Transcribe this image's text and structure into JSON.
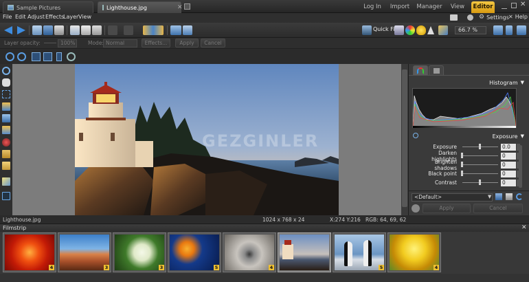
{
  "tabs": {
    "docs": [
      {
        "label": "Sample Pictures",
        "active": false
      },
      {
        "label": "Lighthouse.jpg",
        "active": true
      }
    ],
    "modes": [
      {
        "label": "Log In",
        "active": false
      },
      {
        "label": "Import",
        "active": false
      },
      {
        "label": "Manager",
        "active": false
      },
      {
        "label": "View",
        "active": false
      },
      {
        "label": "Editor",
        "active": true
      }
    ]
  },
  "menu": {
    "items": [
      "File",
      "Edit",
      "Adjust",
      "Effects",
      "Layer",
      "View"
    ],
    "settings": "Settings",
    "help": "Help"
  },
  "toolbar": {
    "quick_fix": "Quick Fix",
    "zoom_level": "66.7 %"
  },
  "options": {
    "layer_opacity_label": "Layer opacity:",
    "layer_opacity_value": "100%",
    "mode_label": "Mode:",
    "mode_value": "Normal",
    "effects_button": "Effects...",
    "apply_button": "Apply",
    "cancel_button": "Cancel"
  },
  "panel": {
    "histogram_title": "Histogram",
    "exposure_title": "Exposure",
    "adjustments": [
      {
        "label": "Exposure",
        "value": "0.0",
        "knob": 0.5
      },
      {
        "label": "Darken highlights",
        "value": "0",
        "knob": 0.0
      },
      {
        "label": "Brighten shadows",
        "value": "0",
        "knob": 0.0
      },
      {
        "label": "Black point",
        "value": "0",
        "knob": 0.0
      },
      {
        "label": "Contrast",
        "value": "0",
        "knob": 0.5
      }
    ],
    "preset": "<Default>",
    "apply_button": "Apply",
    "cancel_button": "Cancel"
  },
  "canvas": {
    "watermark": "GEZGINLER"
  },
  "status": {
    "filename": "Lighthouse.jpg",
    "dimensions": "1024 x 768 x 24",
    "coords": "X:274 Y:216",
    "rgb": "RGB: 64, 69, 62"
  },
  "filmstrip": {
    "title": "Filmstrip",
    "thumbs": [
      {
        "name": "Chrysanthemum",
        "badge": "4",
        "selected": false
      },
      {
        "name": "Desert",
        "badge": "3",
        "selected": false
      },
      {
        "name": "Hydrangeas",
        "badge": "3",
        "selected": false
      },
      {
        "name": "Jellyfish",
        "badge": "5",
        "selected": false
      },
      {
        "name": "Koala",
        "badge": "4",
        "selected": false
      },
      {
        "name": "Lighthouse",
        "badge": "",
        "selected": true
      },
      {
        "name": "Penguins",
        "badge": "5",
        "selected": false
      },
      {
        "name": "Tulips",
        "badge": "4",
        "selected": false
      }
    ]
  },
  "colors": {
    "accent": "#e8b020",
    "panel_bg": "#3a3a3a",
    "canvas_bg": "#7c7c7c"
  }
}
